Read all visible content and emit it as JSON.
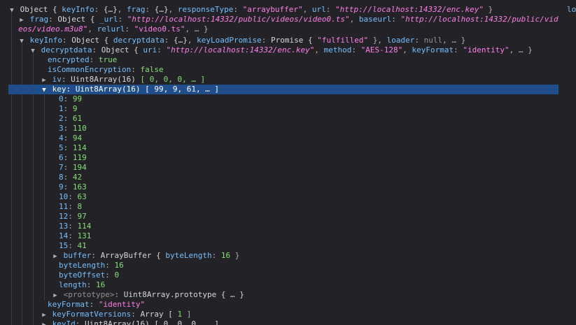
{
  "root": {
    "summary_obj": "Object { ",
    "k_keyInfo": "keyInfo",
    "v_keyInfo": "{…}",
    "k_frag": "frag",
    "v_frag": "{…}",
    "k_responseType": "responseType",
    "v_responseType": "\"arraybuffer\"",
    "k_url": "url",
    "v_url": "\"http://localhost:14332/enc.key\"",
    "close": " }"
  },
  "frag": {
    "key": "frag",
    "obj": "Object { ",
    "k__url": "_url",
    "v__url": "\"http://localhost:14332/public/videos/video0.ts\"",
    "k_baseurl": "baseurl",
    "v_baseurl_part1": "\"http://localhost:14332/public/vid",
    "v_baseurl_part2": "eos/video.m3u8\"",
    "k_relurl": "relurl",
    "v_relurl": "\"video0.ts\"",
    "tail": ", … }"
  },
  "keyInfo": {
    "key": "keyInfo",
    "obj": "Object { ",
    "k_decryptdata": "decryptdata",
    "v_decryptdata": "{…}",
    "k_keyLoadPromise": "keyLoadPromise",
    "v_keyLoadPromise": "Promise { ",
    "v_fulfilled": "\"fulfilled\"",
    "k_loader": "loader",
    "v_loader": "null",
    "tail": ", … }"
  },
  "decryptdata": {
    "key": "decryptdata",
    "obj": "Object { ",
    "k_uri": "uri",
    "v_uri": "\"http://localhost:14332/enc.key\"",
    "k_method": "method",
    "v_method": "\"AES-128\"",
    "k_keyFormat": "keyFormat",
    "v_keyFormat": "\"identity\"",
    "tail": ", … }"
  },
  "props": {
    "encrypted_k": "encrypted",
    "encrypted_v": "true",
    "isCommon_k": "isCommonEncryption",
    "isCommon_v": "false",
    "iv_k": "iv",
    "iv_type": "Uint8Array(16)",
    "iv_preview": "[ 0, 0, 0, … ]",
    "key_k": "key",
    "key_type": "Uint8Array(16)",
    "key_preview": "[ 99, 9, 61, … ]"
  },
  "key_bytes": [
    {
      "i": "0",
      "v": "99"
    },
    {
      "i": "1",
      "v": "9"
    },
    {
      "i": "2",
      "v": "61"
    },
    {
      "i": "3",
      "v": "110"
    },
    {
      "i": "4",
      "v": "94"
    },
    {
      "i": "5",
      "v": "114"
    },
    {
      "i": "6",
      "v": "119"
    },
    {
      "i": "7",
      "v": "194"
    },
    {
      "i": "8",
      "v": "42"
    },
    {
      "i": "9",
      "v": "163"
    },
    {
      "i": "10",
      "v": "63"
    },
    {
      "i": "11",
      "v": "8"
    },
    {
      "i": "12",
      "v": "97"
    },
    {
      "i": "13",
      "v": "114"
    },
    {
      "i": "14",
      "v": "131"
    },
    {
      "i": "15",
      "v": "41"
    }
  ],
  "key_props": {
    "buffer_k": "buffer",
    "buffer_v": "ArrayBuffer { ",
    "buffer_bl_k": "byteLength",
    "buffer_bl_v": "16",
    "byteLength_k": "byteLength",
    "byteLength_v": "16",
    "byteOffset_k": "byteOffset",
    "byteOffset_v": "0",
    "length_k": "length",
    "length_v": "16",
    "proto_k": "<prototype>",
    "proto_v": "Uint8Array.prototype { … }"
  },
  "after": {
    "keyFormat_k": "keyFormat",
    "keyFormat_v": "\"identity\"",
    "keyFormatVersions_k": "keyFormatVersions",
    "keyFormatVersions_v": "Array [ ",
    "keyFormatVersions_n": "1",
    "keyId_k": "keyId",
    "keyId_v": "Uint8Array(16) [ 0, 0, 0, … ]"
  },
  "right_fragment": "loc",
  "colors": {
    "background": "#232327",
    "selected_row": "#204e8a",
    "key": "#75bfff",
    "string": "#ff7de9",
    "number": "#86de74"
  }
}
